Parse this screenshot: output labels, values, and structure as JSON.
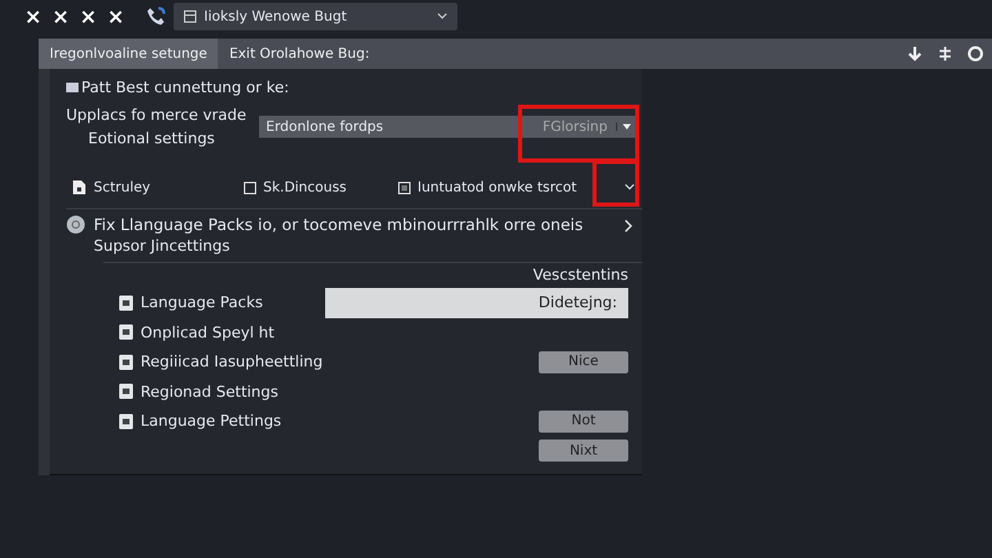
{
  "titlebar": {
    "close_marks": [
      "×",
      "×",
      "×",
      "×"
    ],
    "dropdown": {
      "value": "Iioksly Wenowe Bugt"
    }
  },
  "tabs": [
    {
      "label": "Iregonlvoaline setunge",
      "selected": true
    },
    {
      "label": "Exit Orolahowe Bug:",
      "selected": false
    }
  ],
  "header": {
    "checkbox_label": "Patt Best cunnettung or ke:",
    "checked": false,
    "line_1": "Upplacs fo merce vrade",
    "line_2": "Eotional settings",
    "field_value": "Erdonlone fordps",
    "field_option": "FGlorsinp"
  },
  "options_row": [
    {
      "kind": "file",
      "label": "Sctruley"
    },
    {
      "kind": "checkbox",
      "label": "Sk.Dincouss",
      "checked": false
    },
    {
      "kind": "checkbox",
      "label": "Iuntuatod onwke tsrcot",
      "checked": true
    }
  ],
  "section": {
    "title": "Fix Llanguage Packs io, or tocomeve mbinourrrahlk orre oneis",
    "subtitle": "Supsor Jincettings",
    "column_label": "Vescstentins"
  },
  "items": [
    {
      "label": "Language Packs",
      "control": {
        "kind": "field",
        "value": "Didetejng:"
      }
    },
    {
      "label": "Onplicad Speyl ht"
    },
    {
      "label": "Regiiicad Iasupheettling",
      "control": {
        "kind": "button",
        "label": "Nice"
      }
    },
    {
      "label": "Regionad Settings"
    },
    {
      "label": "Language Pettings",
      "control": {
        "kind": "button",
        "label": "Not"
      }
    },
    {
      "control": {
        "kind": "button",
        "label": "Nixt"
      }
    }
  ]
}
